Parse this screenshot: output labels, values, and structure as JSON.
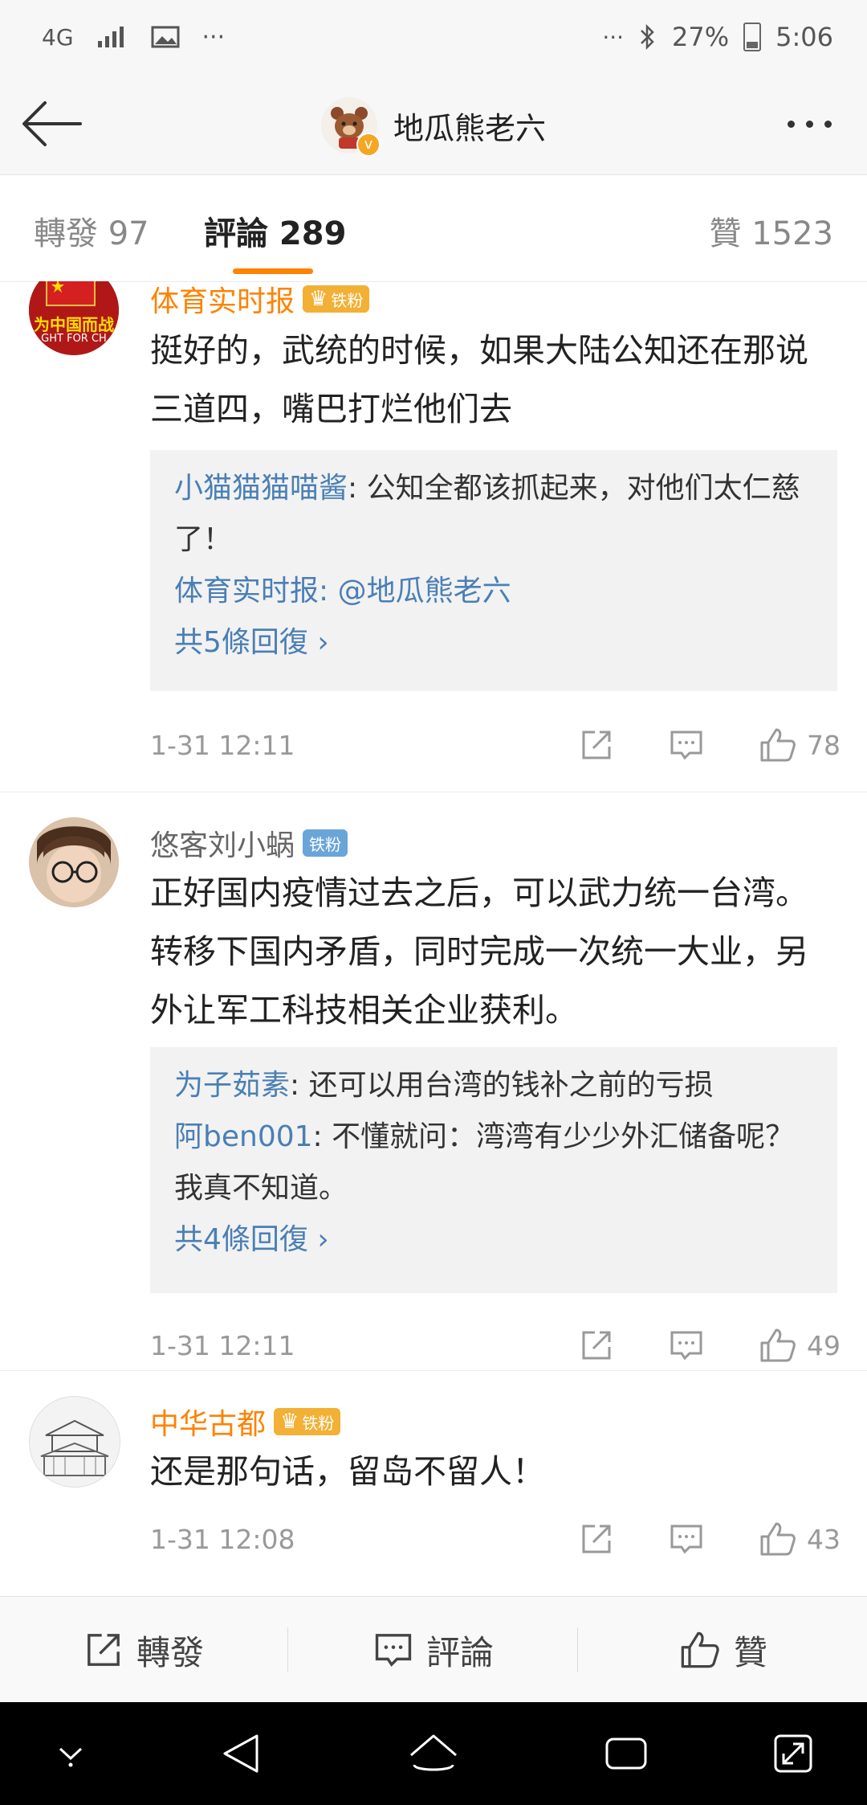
{
  "status_bar": {
    "network": "4G",
    "left_more": "···",
    "right_more": "···",
    "battery": "27%",
    "time": "5:06"
  },
  "header": {
    "title": "地瓜熊老六",
    "verified_badge": "v"
  },
  "tabs": [
    {
      "label": "轉發 97"
    },
    {
      "label": "評論 289"
    },
    {
      "label": "贊 1523"
    }
  ],
  "comments": [
    {
      "user": "体育实时报",
      "badge": "铁粉",
      "vip": true,
      "avatar_text": "为中国而战",
      "avatar_subtext": "GHT FOR CH",
      "text": "挺好的，武统的时候，如果大陆公知还在那说三道四，嘴巴打烂他们去",
      "replies": [
        {
          "user": "小猫猫猫喵酱",
          "text": ": 公知全都该抓起来，对他们太仁慈了！"
        },
        {
          "user": "体育实时报",
          "text": ": @地瓜熊老六"
        }
      ],
      "more_replies": "共5條回復 ›",
      "time": "1-31 12:11",
      "likes": "78"
    },
    {
      "user": "悠客刘小蜗",
      "badge": "铁粉",
      "vip": false,
      "text": "正好国内疫情过去之后，可以武力统一台湾。转移下国内矛盾，同时完成一次统一大业，另外让军工科技相关企业获利。",
      "replies": [
        {
          "user": "为子茹素",
          "text": ": 还可以用台湾的钱补之前的亏损"
        },
        {
          "user": "阿ben001",
          "text": ": 不懂就问：湾湾有少少外汇储备呢？我真不知道。"
        }
      ],
      "more_replies": "共4條回復 ›",
      "time": "1-31 12:11",
      "likes": "49"
    },
    {
      "user": "中华古都",
      "badge": "铁粉",
      "vip": true,
      "text": "还是那句话，留岛不留人！",
      "time": "1-31 12:08",
      "likes": "43"
    }
  ],
  "toolbar": {
    "repost": "轉發",
    "comment": "評論",
    "like": "贊"
  }
}
